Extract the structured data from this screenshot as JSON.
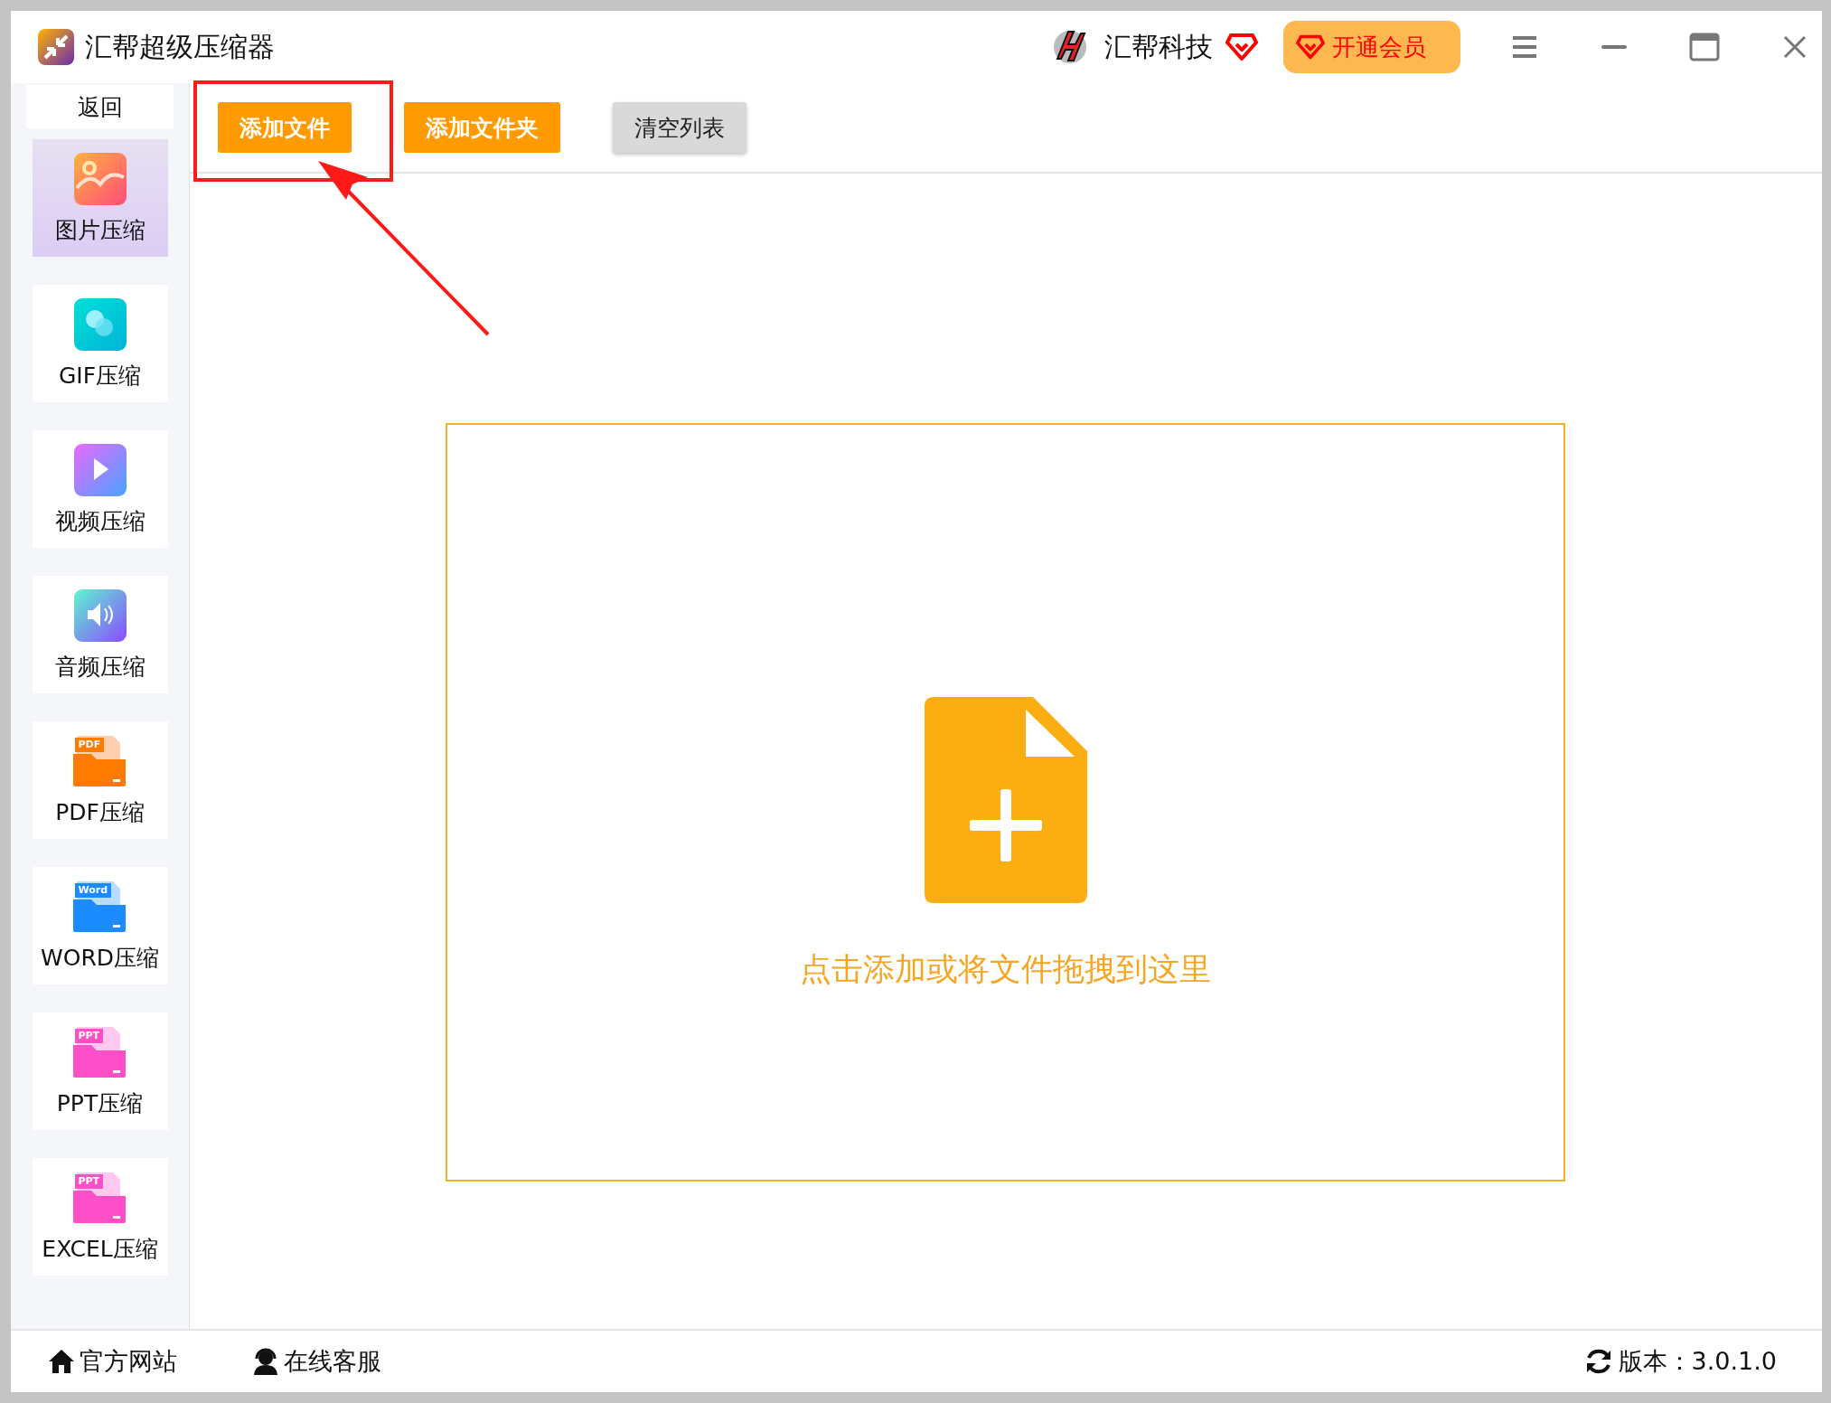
{
  "window": {
    "title": "汇帮超级压缩器"
  },
  "header": {
    "brand": "汇帮科技",
    "vip_button": "开通会员"
  },
  "sidebar": {
    "back": "返回",
    "items": [
      {
        "label": "图片压缩",
        "kind": "image",
        "selected": true
      },
      {
        "label": "GIF压缩",
        "kind": "gif",
        "selected": false
      },
      {
        "label": "视频压缩",
        "kind": "video",
        "selected": false
      },
      {
        "label": "音频压缩",
        "kind": "audio",
        "selected": false
      },
      {
        "label": "PDF压缩",
        "kind": "pdf",
        "badge": "PDF",
        "selected": false
      },
      {
        "label": "WORD压缩",
        "kind": "word",
        "badge": "Word",
        "selected": false
      },
      {
        "label": "PPT压缩",
        "kind": "ppt",
        "badge": "PPT",
        "selected": false
      },
      {
        "label": "EXCEL压缩",
        "kind": "ppt",
        "badge": "PPT",
        "selected": false
      }
    ]
  },
  "toolbar": {
    "buttons": [
      {
        "label": "添加文件",
        "kind": "primary"
      },
      {
        "label": "添加文件夹",
        "kind": "primary"
      },
      {
        "label": "清空列表",
        "kind": "secondary"
      }
    ]
  },
  "drop_zone": {
    "hint": "点击添加或将文件拖拽到这里"
  },
  "status_bar": {
    "links": [
      {
        "label": "官方网站",
        "kind": "home"
      },
      {
        "label": "在线客服",
        "kind": "support"
      }
    ],
    "version": "版本：3.0.1.0"
  }
}
